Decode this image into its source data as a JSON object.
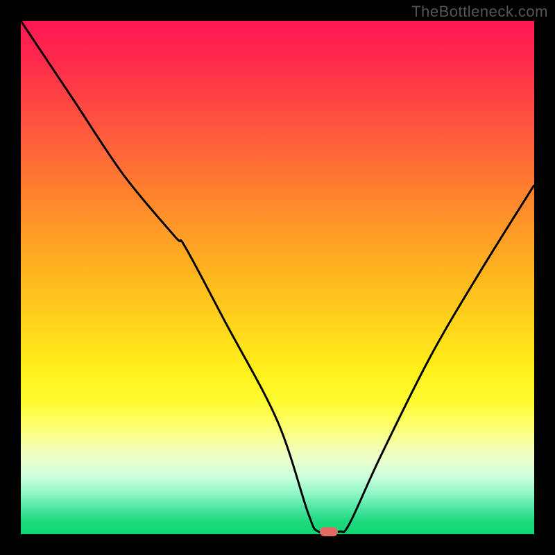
{
  "watermark": "TheBottleneck.com",
  "colors": {
    "background": "#000000",
    "curve_stroke": "#000000",
    "marker_fill": "#e26a63",
    "gradient_top": "#ff1754",
    "gradient_mid": "#ffd71b",
    "gradient_bottom": "#0fd873"
  },
  "chart_data": {
    "type": "line",
    "title": "",
    "xlabel": "",
    "ylabel": "",
    "xlim": [
      0,
      100
    ],
    "ylim": [
      0,
      100
    ],
    "x": [
      0,
      10,
      20,
      30,
      32,
      40,
      50,
      56,
      58,
      62,
      64,
      70,
      80,
      90,
      100
    ],
    "values": [
      100,
      85,
      70,
      58,
      56,
      41,
      22,
      4,
      0.5,
      0.5,
      2,
      15,
      35,
      52,
      68
    ],
    "annotations": [
      {
        "name": "optimal-marker",
        "x": 60,
        "y": 0.5
      }
    ],
    "notes": "Vertical gradient encodes bottleneck severity: red = high, green = low. Curve marks bottleneck level; red pill marks optimal point at minimum."
  }
}
